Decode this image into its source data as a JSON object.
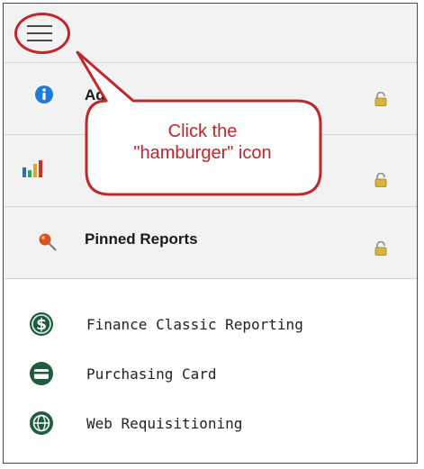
{
  "header": {
    "menu_icon": "hamburger-menu-icon"
  },
  "menu_rows": [
    {
      "label": "Ad",
      "icon": "info-icon",
      "lock_icon": "lock-icon"
    },
    {
      "label": "",
      "icon": "bar-chart-icon",
      "lock_icon": "lock-icon"
    },
    {
      "label": "Pinned Reports",
      "icon": "pushpin-icon",
      "lock_icon": "lock-icon"
    }
  ],
  "apps": [
    {
      "label": "Finance Classic Reporting",
      "icon": "dollar-circle-icon"
    },
    {
      "label": "Purchasing Card",
      "icon": "credit-card-circle-icon"
    },
    {
      "label": "Web Requisitioning",
      "icon": "globe-circle-icon"
    }
  ],
  "callout": {
    "line1": "Click the",
    "line2": "\"hamburger\" icon"
  },
  "colors": {
    "callout_red": "#c0262a",
    "app_icon_green": "#1f5b3d",
    "info_blue": "#1e7ad9",
    "lock_gold": "#c9a227"
  }
}
